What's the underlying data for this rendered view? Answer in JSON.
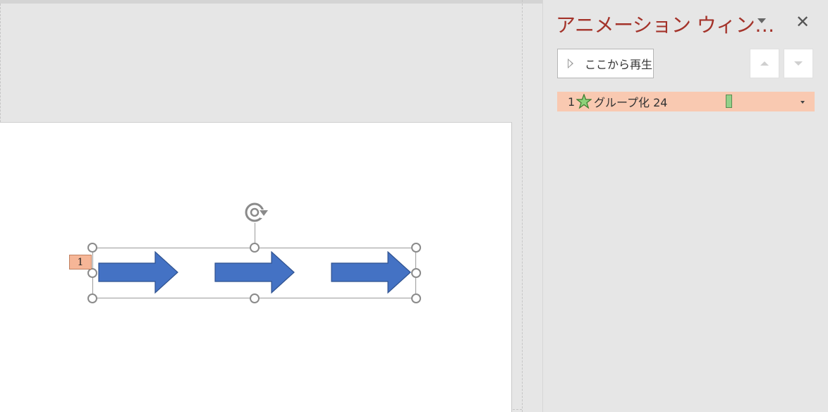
{
  "slide": {
    "animation_tag": "1"
  },
  "pane": {
    "title": "アニメーション ウィン…",
    "close_glyph": "✕",
    "play_from_here": "ここから再生",
    "items": [
      {
        "order": "1",
        "effect_icon": "star-icon",
        "name": "グループ化 24"
      }
    ]
  },
  "colors": {
    "accent_title": "#a4332a",
    "arrow_fill": "#4472c4",
    "item_highlight": "#f9c9b1",
    "timeline_bar": "#92d089"
  }
}
